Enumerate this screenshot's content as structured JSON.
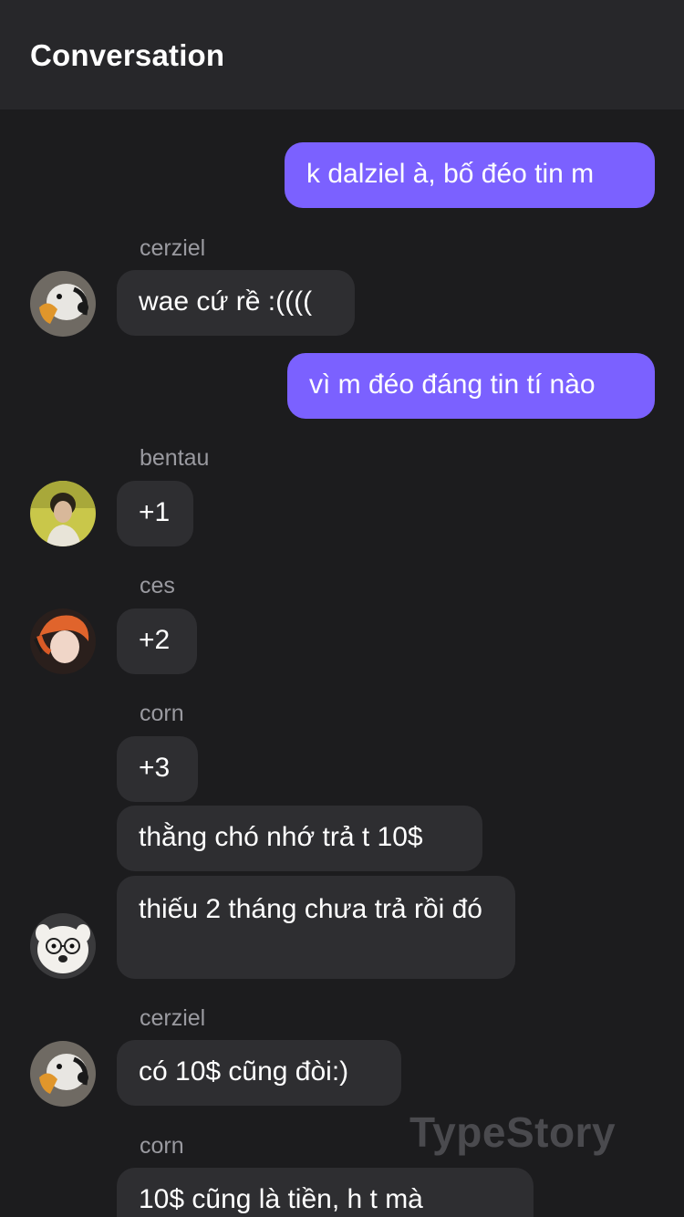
{
  "header": {
    "title": "Conversation"
  },
  "messages": [
    {
      "text": "k dalziel à, bố đéo tin m"
    },
    {
      "sender": "cerziel",
      "text": "wae cứ rề :(((("
    },
    {
      "text": "vì m đéo đáng tin tí nào"
    },
    {
      "sender": "bentau",
      "text": "+1"
    },
    {
      "sender": "ces",
      "text": "+2"
    },
    {
      "sender": "corn",
      "text": "+3"
    },
    {
      "text": "thằng chó nhớ trả t 10$"
    },
    {
      "text": "thiếu 2 tháng chưa trả rồi đó"
    },
    {
      "sender": "cerziel",
      "text": "có 10$ cũng đòi:)"
    },
    {
      "sender": "corn",
      "text": "10$ cũng là tiền, h t mà"
    }
  ],
  "watermark": "TypeStory",
  "colors": {
    "outgoing": "#7b61ff",
    "incoming": "#2e2e31",
    "background": "#1c1c1e",
    "header": "#27272a"
  }
}
